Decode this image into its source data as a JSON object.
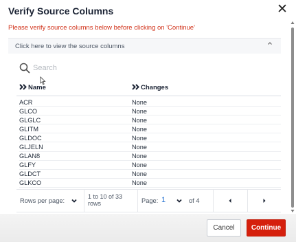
{
  "dialog": {
    "title": "Verify Source Columns",
    "close_icon": "✕",
    "warning": "Please verify source columns below before clicking on 'Continue'"
  },
  "panel": {
    "toggle_label": "Click here to view the source columns",
    "search": {
      "placeholder": "Search",
      "value": ""
    }
  },
  "table": {
    "columns": [
      "Name",
      "Changes"
    ],
    "rows": [
      [
        "ACR",
        "None"
      ],
      [
        "GLCO",
        "None"
      ],
      [
        "GLGLC",
        "None"
      ],
      [
        "GLITM",
        "None"
      ],
      [
        "GLDOC",
        "None"
      ],
      [
        "GLJELN",
        "None"
      ],
      [
        "GLAN8",
        "None"
      ],
      [
        "GLFY",
        "None"
      ],
      [
        "GLDCT",
        "None"
      ],
      [
        "GLKCO",
        "None"
      ]
    ]
  },
  "pagination": {
    "rows_per_page_label": "Rows per page:",
    "range_text": "1 to 10 of 33 rows",
    "page_label": "Page:",
    "current_page": "1",
    "of_pages": "of 4"
  },
  "buttons": {
    "cancel": "Cancel",
    "continue": "Continue"
  },
  "colors": {
    "accent": "#d51f0c",
    "warning_text": "#d1321a",
    "page_number": "#1f6fd1"
  }
}
